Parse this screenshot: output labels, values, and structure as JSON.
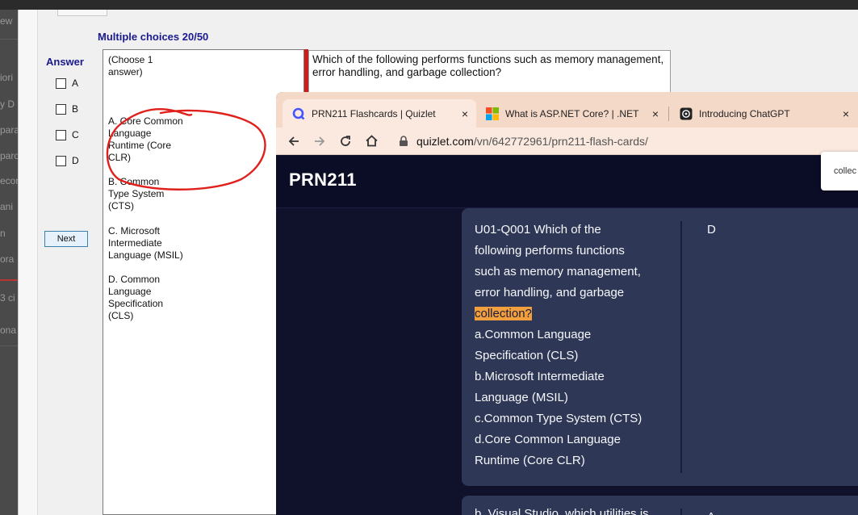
{
  "background_app": {
    "fragments": [
      "ew",
      "iori",
      "y D",
      "para",
      "paro",
      "ecor",
      "ani",
      "n",
      "ora",
      "3 ci",
      "ona"
    ]
  },
  "exam": {
    "title": "Multiple choices 20/50",
    "answer_label": "Answer",
    "checkbox_labels": [
      "A",
      "B",
      "C",
      "D"
    ],
    "next_button": "Next",
    "choose_hint": "(Choose 1\nanswer)",
    "options": [
      "A.  Core Common\nLanguage\nRuntime (Core\nCLR)",
      "B.  Common\nType System\n(CTS)",
      "C.  Microsoft\nIntermediate\nLanguage (MSIL)",
      "D.  Common\nLanguage\nSpecification\n(CLS)"
    ],
    "question": "Which of the following performs functions such as memory management, error handling, and garbage collection?",
    "circle_color": "#e0201c"
  },
  "browser": {
    "tabs": [
      {
        "title": "PRN211 Flashcards | Quizlet",
        "icon": "quizlet-icon",
        "active": true
      },
      {
        "title": "What is ASP.NET Core? | .NET",
        "icon": "microsoft-icon",
        "active": false
      },
      {
        "title": "Introducing ChatGPT",
        "icon": "openai-icon",
        "active": false
      }
    ],
    "close_glyph": "×",
    "url_domain": "quizlet.com",
    "url_path": "/vn/642772961/prn211-flash-cards/",
    "brand": "PRN211",
    "popup_text": "collec",
    "card": {
      "term_lines": [
        "U01-Q001 Which of the",
        "following performs functions",
        "such as memory management,",
        "error handling, and garbage"
      ],
      "highlight": "collection?",
      "answer_lines": [
        "a.Common Language",
        "Specification (CLS)",
        "b.Microsoft Intermediate",
        "Language (MSIL)",
        "c.Common Type System (CTS)",
        "d.Core Common Language",
        "Runtime (Core CLR)"
      ],
      "definition": "D"
    },
    "next_card_partial": "b. Visual Studio, which utilities is",
    "next_card_partial_def": "A",
    "colors": {
      "tab_strip": "#f4d8c8",
      "page_bg": "#10112b",
      "card_bg": "#2e3856",
      "highlight": "#f2a03d"
    }
  }
}
